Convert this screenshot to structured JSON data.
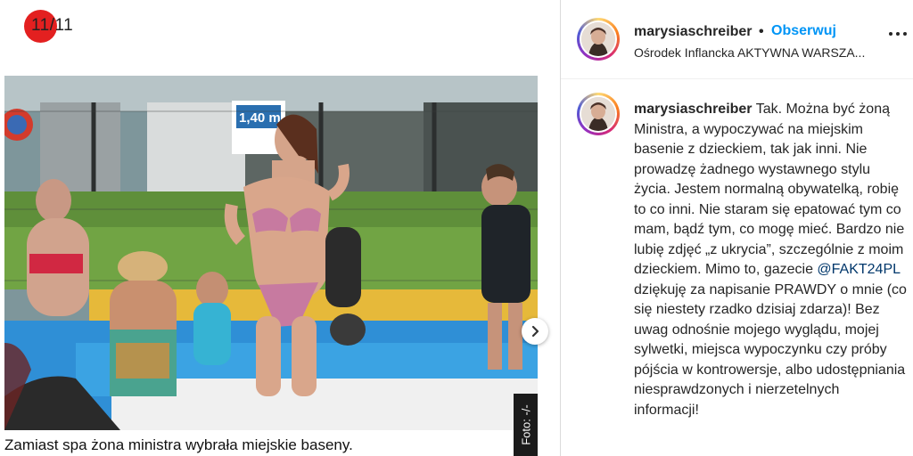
{
  "gallery": {
    "counter": "11/11",
    "credit": "Foto: -/-",
    "caption": "Zamiast spa żona ministra wybrała miejskie baseny.",
    "pool_sign": "1,40 m"
  },
  "post": {
    "username": "marysiaschreiber",
    "separator": "•",
    "follow_label": "Obserwuj",
    "location": "Ośrodek Inflancka AKTYWNA WARSZA...",
    "comment": {
      "username": "marysiaschreiber",
      "text_before": " Tak. Można być żoną Ministra, a wypoczywać na miejskim basenie z dzieckiem, tak jak inni. Nie prowadzę żadnego wystawnego stylu życia. Jestem normalną obywatelką, robię to co inni. Nie staram się epatować tym co mam, bądź tym, co mogę mieć. Bardzo nie lubię zdjęć „z ukrycia”, szczególnie z moim dzieckiem. Mimo to, gazecie ",
      "mention": "@FAKT24PL",
      "text_after": " dziękuję za napisanie PRAWDY o mnie (co się niestety rzadko dzisiaj zdarza)! Bez uwag odnośnie mojego wyglądu, mojej sylwetki, miejsca wypoczynku czy próby pójścia w kontrowersje, albo udostępniania niesprawdzonych i nierzetelnych informacji!"
    }
  },
  "colors": {
    "counter_badge": "#e32020",
    "follow": "#0095f6",
    "mention": "#00376b"
  }
}
